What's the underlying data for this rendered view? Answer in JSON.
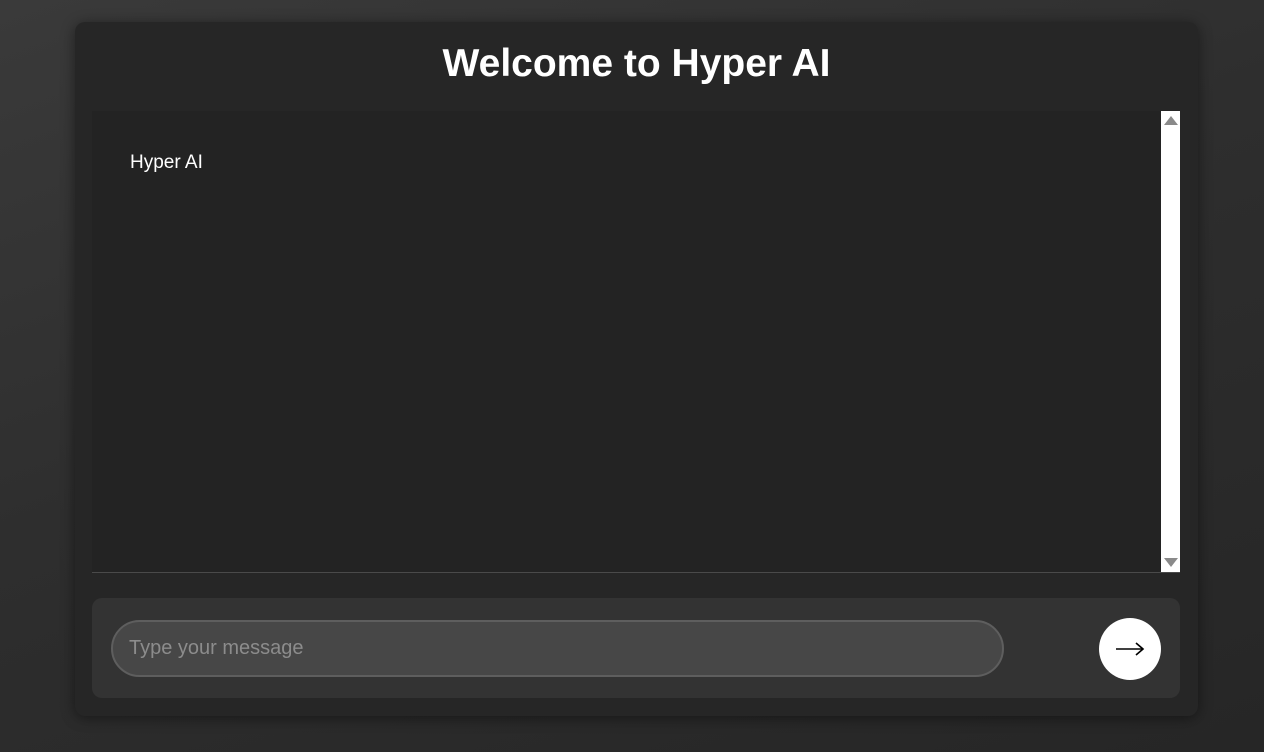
{
  "header": {
    "title": "Welcome to Hyper AI"
  },
  "chat": {
    "messages": [
      {
        "text": "Hyper AI"
      }
    ]
  },
  "composer": {
    "placeholder": "Type your message",
    "value": "",
    "send_icon": "arrow-right-icon"
  },
  "colors": {
    "background": "#2e2e2e",
    "panel": "#262626",
    "chat_area": "#232323",
    "input_bar": "#333333",
    "input_field": "#474747",
    "text": "#ffffff",
    "send_button": "#ffffff"
  }
}
